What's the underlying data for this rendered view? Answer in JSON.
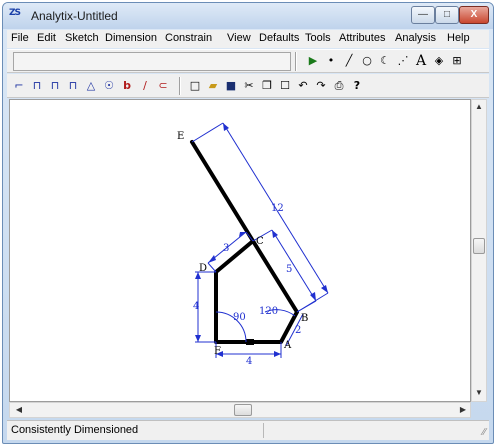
{
  "window": {
    "title": "Analytix-Untitled",
    "app_icon_text": "ZS",
    "min_glyph": "—",
    "max_glyph": "□",
    "close_glyph": "X"
  },
  "menu": [
    "File",
    "Edit",
    "Sketch",
    "Dimension",
    "Constrain",
    "View",
    "Defaults",
    "Tools",
    "Attributes",
    "Analysis",
    "Help"
  ],
  "toolbar_sketch_icons": [
    "select-arrow-icon",
    "point-icon",
    "line-icon",
    "circle-icon",
    "arc-icon",
    "construction-line-icon",
    "text-icon",
    "fill-icon",
    "grid-icon"
  ],
  "toolbar_glyphs": {
    "select": "▶",
    "point": "•",
    "line": "╱",
    "circle": "○",
    "arc": "☾",
    "dashline": "⋰",
    "text": "A",
    "fill": "◈",
    "grid": "⊞"
  },
  "toolbar2_glyphs": {
    "dim1": "⌐",
    "dim2": "⊓",
    "dim3": "⊓",
    "dim4": "⊓",
    "angle": "△",
    "radius": "☉",
    "b": "b",
    "slash": "∕",
    "q": "⊂",
    "new": "□",
    "open": "▰",
    "save": "■",
    "cut": "✂",
    "copy": "❐",
    "paste": "☐",
    "undo": "↶",
    "redo": "↷",
    "print": "⎙",
    "help": "?"
  },
  "drawing": {
    "points": {
      "E": {
        "label": "E"
      },
      "C": {
        "label": "C"
      },
      "D": {
        "label": "D"
      },
      "F": {
        "label": "F"
      },
      "A": {
        "label": "A"
      },
      "B": {
        "label": "B"
      }
    },
    "dimensions": {
      "EB": "12",
      "CB": "5",
      "DC": "3",
      "DF": "4",
      "FA": "4",
      "AB": "2",
      "angle_F": "90",
      "angle_A": "120"
    }
  },
  "scroll": {
    "up": "▲",
    "down": "▼",
    "left": "◀",
    "right": "▶"
  },
  "status": {
    "text": "Consistently Dimensioned",
    "grip": "∕∕"
  }
}
